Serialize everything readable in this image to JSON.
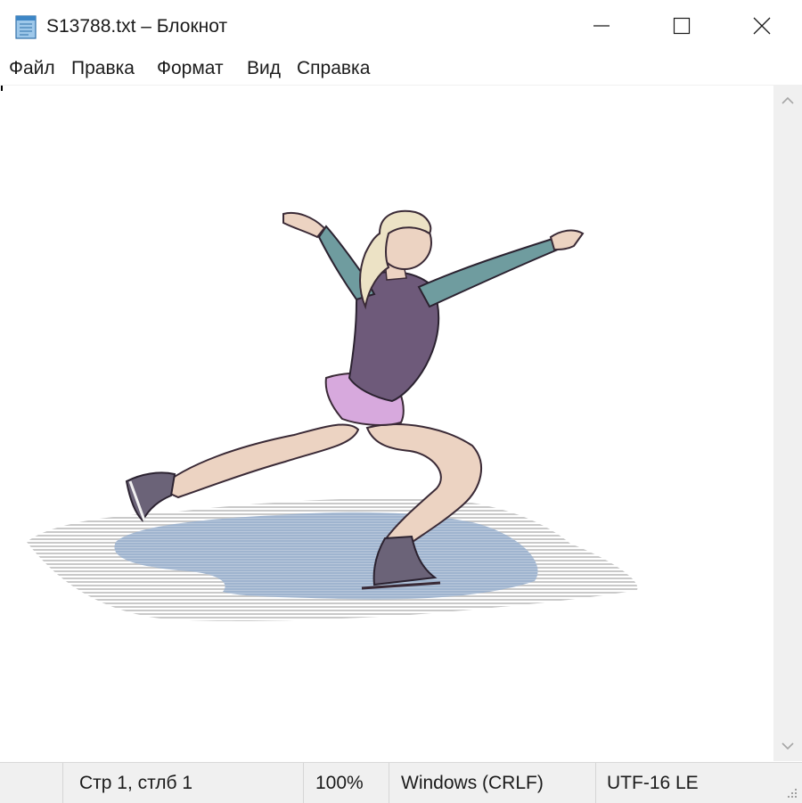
{
  "window": {
    "title": "S13788.txt – Блокнот",
    "app_icon": "notepad-icon",
    "controls": {
      "minimize_icon": "minimize-icon",
      "maximize_icon": "maximize-icon",
      "close_icon": "close-icon"
    }
  },
  "menu": {
    "file": "Файл",
    "edit": "Правка",
    "format": "Формат",
    "view": "Вид",
    "help": "Справка"
  },
  "editor": {
    "content_image": "figure-skater-illustration"
  },
  "scrollbar": {
    "up_icon": "chevron-up-icon",
    "down_icon": "chevron-down-icon"
  },
  "status": {
    "position": "Стр 1, стлб 1",
    "zoom": "100%",
    "line_endings": "Windows (CRLF)",
    "encoding": "UTF-16 LE"
  },
  "colors": {
    "chrome": "#f0f0f0",
    "ice": "#9fb4cf",
    "dress_top": "#6e5a7a",
    "skirt": "#d7a9dd",
    "sleeves": "#6f9c9f",
    "skin": "#ecd3c2",
    "hair": "#ece2c5"
  }
}
